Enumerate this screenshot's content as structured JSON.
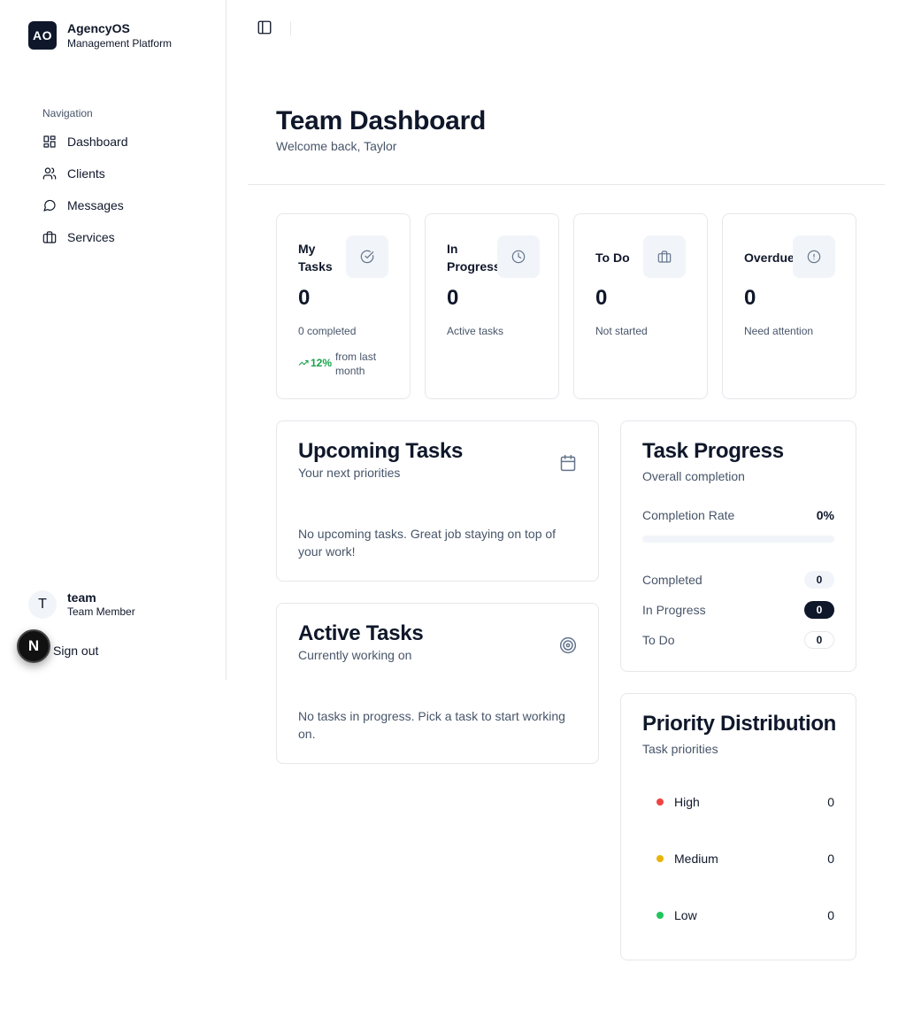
{
  "brand": {
    "logo": "AO",
    "name": "AgencyOS",
    "subtitle": "Management Platform"
  },
  "nav": {
    "label": "Navigation",
    "items": [
      {
        "label": "Dashboard",
        "icon": "dashboard-grid-icon"
      },
      {
        "label": "Clients",
        "icon": "users-icon"
      },
      {
        "label": "Messages",
        "icon": "message-circle-icon"
      },
      {
        "label": "Services",
        "icon": "briefcase-icon"
      }
    ]
  },
  "user": {
    "initial": "T",
    "name": "team",
    "role": "Team Member",
    "signout": "Sign out",
    "badge": "N"
  },
  "header": {
    "title": "Team Dashboard",
    "subtitle": "Welcome back, Taylor"
  },
  "stats": [
    {
      "label": "My Tasks",
      "value": "0",
      "desc": "0 completed",
      "trend": "12%",
      "trend_text": "from last month",
      "icon": "check-circle-icon"
    },
    {
      "label": "In Progress",
      "value": "0",
      "desc": "Active tasks",
      "icon": "clock-icon"
    },
    {
      "label": "To Do",
      "value": "0",
      "desc": "Not started",
      "icon": "briefcase-icon"
    },
    {
      "label": "Overdue",
      "value": "0",
      "desc": "Need attention",
      "icon": "alert-circle-icon"
    }
  ],
  "upcoming": {
    "title": "Upcoming Tasks",
    "subtitle": "Your next priorities",
    "empty": "No upcoming tasks. Great job staying on top of your work!",
    "icon": "calendar-icon"
  },
  "active": {
    "title": "Active Tasks",
    "subtitle": "Currently working on",
    "empty": "No tasks in progress. Pick a task to start working on.",
    "icon": "target-icon"
  },
  "progress": {
    "title": "Task Progress",
    "subtitle": "Overall completion",
    "rate_label": "Completion Rate",
    "rate_value": "0%",
    "rate_fraction": 0,
    "rows": [
      {
        "label": "Completed",
        "value": "0"
      },
      {
        "label": "In Progress",
        "value": "0"
      },
      {
        "label": "To Do",
        "value": "0"
      }
    ]
  },
  "priority": {
    "title": "Priority Distribution",
    "subtitle": "Task priorities",
    "items": [
      {
        "label": "High",
        "value": "0",
        "color": "#ef4444"
      },
      {
        "label": "Medium",
        "value": "0",
        "color": "#eab308"
      },
      {
        "label": "Low",
        "value": "0",
        "color": "#22c55e"
      }
    ]
  }
}
